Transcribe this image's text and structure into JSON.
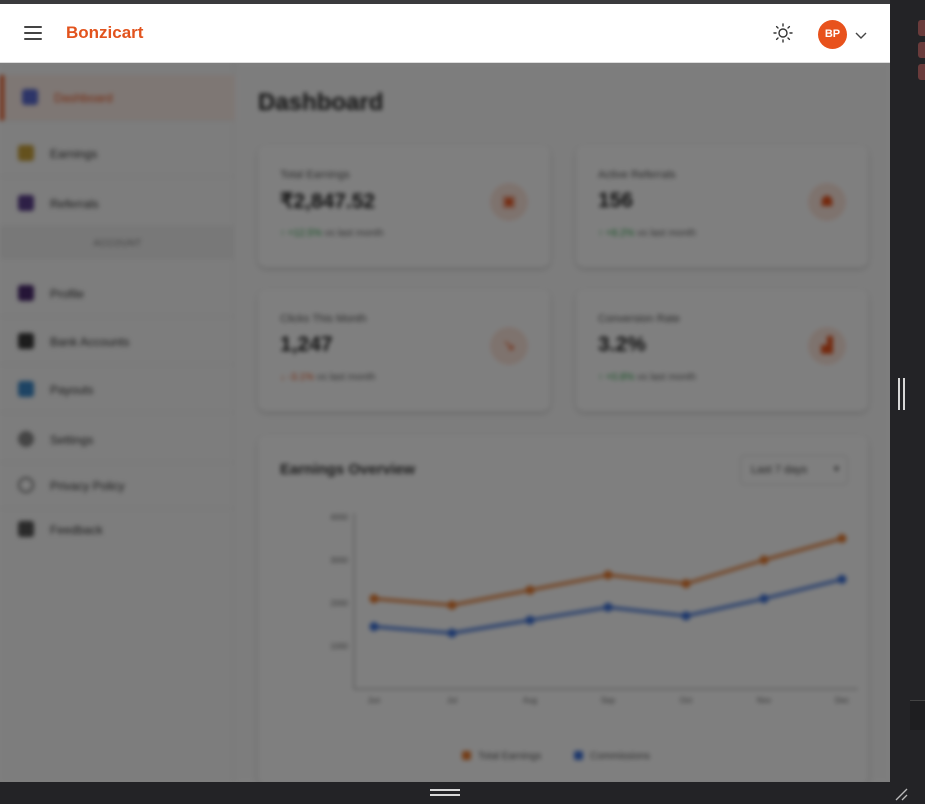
{
  "header": {
    "brand": "Bonzicart",
    "menu_icon": "hamburger-icon",
    "theme_icon": "sun-icon",
    "avatar_initials": "BP",
    "avatar_icon": "chevron-down-icon"
  },
  "sidebar": {
    "items": [
      {
        "label": "Dashboard",
        "icon": "dashboard-icon",
        "active": true,
        "color": "#5a6ad0"
      },
      {
        "label": "Earnings",
        "icon": "money-bag-icon",
        "active": false,
        "color": "#c9a23b"
      },
      {
        "label": "Referrals",
        "icon": "referrals-icon",
        "active": false,
        "color": "#5b3f8c"
      }
    ],
    "section_label": "ACCOUNT",
    "account_items": [
      {
        "label": "Profile",
        "icon": "user-icon",
        "color": "#4a2a6e"
      },
      {
        "label": "Bank Accounts",
        "icon": "bank-icon",
        "color": "#3a3a3a"
      },
      {
        "label": "Payouts",
        "icon": "payout-icon",
        "color": "#3c88c8"
      },
      {
        "label": "Settings",
        "icon": "gear-icon",
        "color": "#8a8a8a"
      },
      {
        "label": "Privacy Policy",
        "icon": "shield-icon",
        "color": "#777777"
      },
      {
        "label": "Feedback",
        "icon": "feedback-icon",
        "color": "#555555"
      }
    ]
  },
  "main": {
    "title": "Dashboard",
    "stats": [
      {
        "label": "Total Earnings",
        "value": "₹2,847.52",
        "change": "+12.5%",
        "trend": "up",
        "suffix": "vs last month",
        "icon": "wallet-icon"
      },
      {
        "label": "Active Referrals",
        "value": "156",
        "change": "+8.2%",
        "trend": "up",
        "suffix": "vs last month",
        "icon": "users-icon"
      },
      {
        "label": "Clicks This Month",
        "value": "1,247",
        "change": "-3.1%",
        "trend": "down",
        "suffix": "vs last month",
        "icon": "cursor-icon"
      },
      {
        "label": "Conversion Rate",
        "value": "3.2%",
        "change": "+0.8%",
        "trend": "up",
        "suffix": "vs last month",
        "icon": "bar-chart-icon"
      }
    ],
    "chart_card": {
      "title": "Earnings Overview",
      "range": "Last 7 days"
    }
  },
  "colors": {
    "accent": "#e8521c",
    "series_earnings": "#e87a2e",
    "series_commissions": "#3a6fd8"
  },
  "chart_data": {
    "type": "line",
    "categories": [
      "Jun",
      "Jul",
      "Aug",
      "Sep",
      "Oct",
      "Nov",
      "Dec"
    ],
    "series": [
      {
        "name": "Total Earnings",
        "values": [
          2100,
          1950,
          2300,
          2650,
          2450,
          3000,
          3500
        ]
      },
      {
        "name": "Commissions",
        "values": [
          1450,
          1300,
          1600,
          1900,
          1700,
          2100,
          2550
        ]
      }
    ],
    "yticks": [
      "4000",
      "3000",
      "2000",
      "1000"
    ],
    "ylim": [
      0,
      4000
    ],
    "legend": "bottom"
  }
}
